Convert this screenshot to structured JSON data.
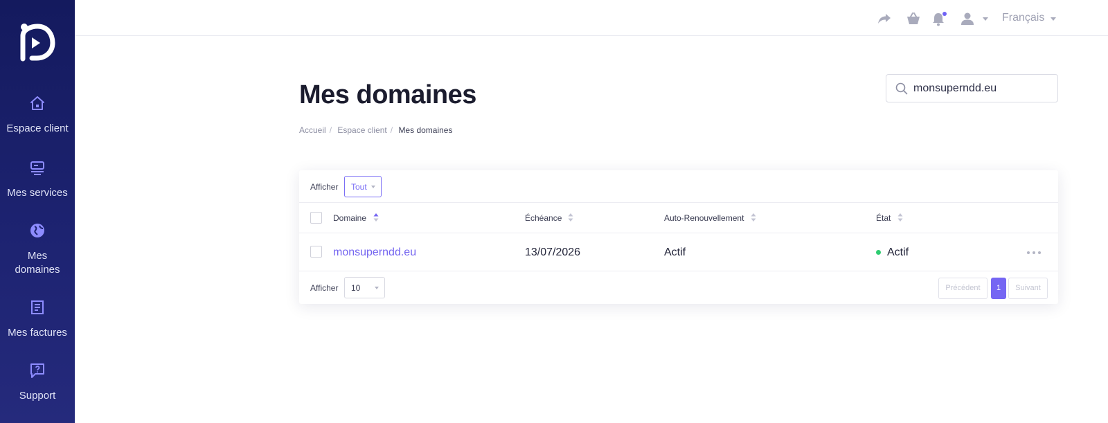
{
  "sidebar": {
    "items": [
      {
        "label": "Espace client",
        "icon": "home-icon"
      },
      {
        "label": "Mes services",
        "icon": "services-icon"
      },
      {
        "label": "Mes domaines",
        "icon": "globe-icon"
      },
      {
        "label": "Mes factures",
        "icon": "invoice-icon"
      },
      {
        "label": "Support",
        "icon": "support-chat-icon"
      }
    ]
  },
  "topbar": {
    "language": "Français",
    "icons": [
      "share-icon",
      "basket-icon",
      "bell-icon",
      "user-icon"
    ]
  },
  "main": {
    "title": "Mes domaines",
    "breadcrumb": [
      "Accueil",
      "Espace client",
      "Mes domaines"
    ],
    "search": {
      "value": "monsuperndd.eu",
      "placeholder": ""
    }
  },
  "table": {
    "filter_label": "Afficher",
    "filter_value": "Tout",
    "columns": [
      "Domaine",
      "Échéance",
      "Auto-Renouvellement",
      "État"
    ],
    "rows": [
      {
        "domain": "monsuperndd.eu",
        "expiry": "13/07/2026",
        "auto_renew": "Actif",
        "status": "Actif"
      }
    ],
    "page_size_label": "Afficher",
    "page_size_value": "10",
    "pagination": {
      "prev": "Précédent",
      "current": "1",
      "next": "Suivant"
    }
  },
  "colors": {
    "sidebar": "#1a2069",
    "accent": "#7566f3",
    "status_active": "#2ecc71"
  }
}
